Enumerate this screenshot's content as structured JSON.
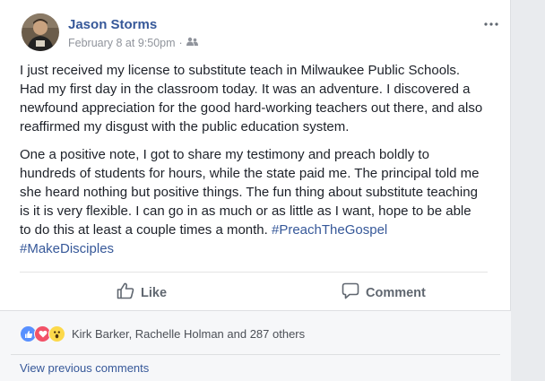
{
  "post": {
    "author": "Jason Storms",
    "date": "February 8 at 9:50pm",
    "separator": "·",
    "paragraph1": "I just received my license to substitute teach in Milwaukee Public Schools. Had my first day in the classroom today. It was an adventure. I discovered a newfound appreciation for the good hard-working teachers out there, and also reaffirmed my disgust with the public education system.",
    "paragraph2_text": "One a positive note, I got to share my testimony and preach boldly to hundreds of students for hours, while the state paid me. The principal told me she heard nothing but positive things. The fun thing about substitute teaching is it is very flexible. I can go in as much or as little as I want, hope to be able to do this at least a couple times a month. ",
    "hashtag1": "#PreachTheGospel",
    "hashtag2": "#MakeDisciples"
  },
  "actions": {
    "like_label": "Like",
    "comment_label": "Comment"
  },
  "reactions": {
    "names": "Kirk Barker, Rachelle Holman and 287 others",
    "icons": [
      "like-reaction",
      "love-reaction",
      "wow-reaction"
    ]
  },
  "comments": {
    "view_previous": "View previous comments"
  },
  "colors": {
    "link": "#365899",
    "like_blue": "#5890ff",
    "love_red": "#f25268",
    "wow_yellow": "#fcd94a"
  }
}
